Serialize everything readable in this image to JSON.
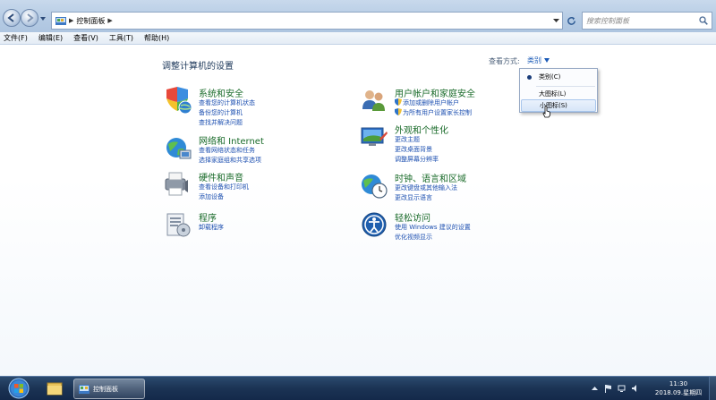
{
  "window": {
    "breadcrumb": [
      "控制面板"
    ],
    "search_placeholder": "搜索控制面板"
  },
  "menubar": [
    "文件(F)",
    "编辑(E)",
    "查看(V)",
    "工具(T)",
    "帮助(H)"
  ],
  "main": {
    "title": "调整计算机的设置",
    "view_by_label": "查看方式:",
    "view_by_value": "类别"
  },
  "view_menu": {
    "items": [
      {
        "label": "类别(C)",
        "selected": true
      },
      {
        "label": "大图标(L)",
        "selected": false
      },
      {
        "label": "小图标(S)",
        "selected": false,
        "hover": true
      }
    ]
  },
  "categories": [
    {
      "title": "系统和安全",
      "icon": "shield-globe-icon",
      "links": [
        "查看您的计算机状态",
        "备份您的计算机",
        "查找并解决问题"
      ]
    },
    {
      "title": "网络和 Internet",
      "icon": "network-globe-icon",
      "links": [
        "查看网络状态和任务",
        "选择家庭组和共享选项"
      ]
    },
    {
      "title": "硬件和声音",
      "icon": "printer-speaker-icon",
      "links": [
        "查看设备和打印机",
        "添加设备"
      ]
    },
    {
      "title": "程序",
      "icon": "programs-icon",
      "links": [
        "卸载程序"
      ]
    },
    {
      "title": "用户帐户和家庭安全",
      "icon": "users-icon",
      "links": [
        "添加或删除用户帐户",
        "为所有用户设置家长控制"
      ]
    },
    {
      "title": "外观和个性化",
      "icon": "appearance-icon",
      "links": [
        "更改主题",
        "更改桌面背景",
        "调整屏幕分辨率"
      ]
    },
    {
      "title": "时钟、语言和区域",
      "icon": "clock-globe-icon",
      "links": [
        "更改键盘或其他输入法",
        "更改显示语言"
      ]
    },
    {
      "title": "轻松访问",
      "icon": "accessibility-icon",
      "links": [
        "使用 Windows 建议的设置",
        "优化视频显示"
      ]
    }
  ],
  "taskbar": {
    "active_window": "控制面板",
    "time": "11:30",
    "date": "2018.09.星期四"
  },
  "colors": {
    "link": "#1c4fb0",
    "category_title": "#1a6b2a",
    "taskbar": "#1b3354"
  }
}
